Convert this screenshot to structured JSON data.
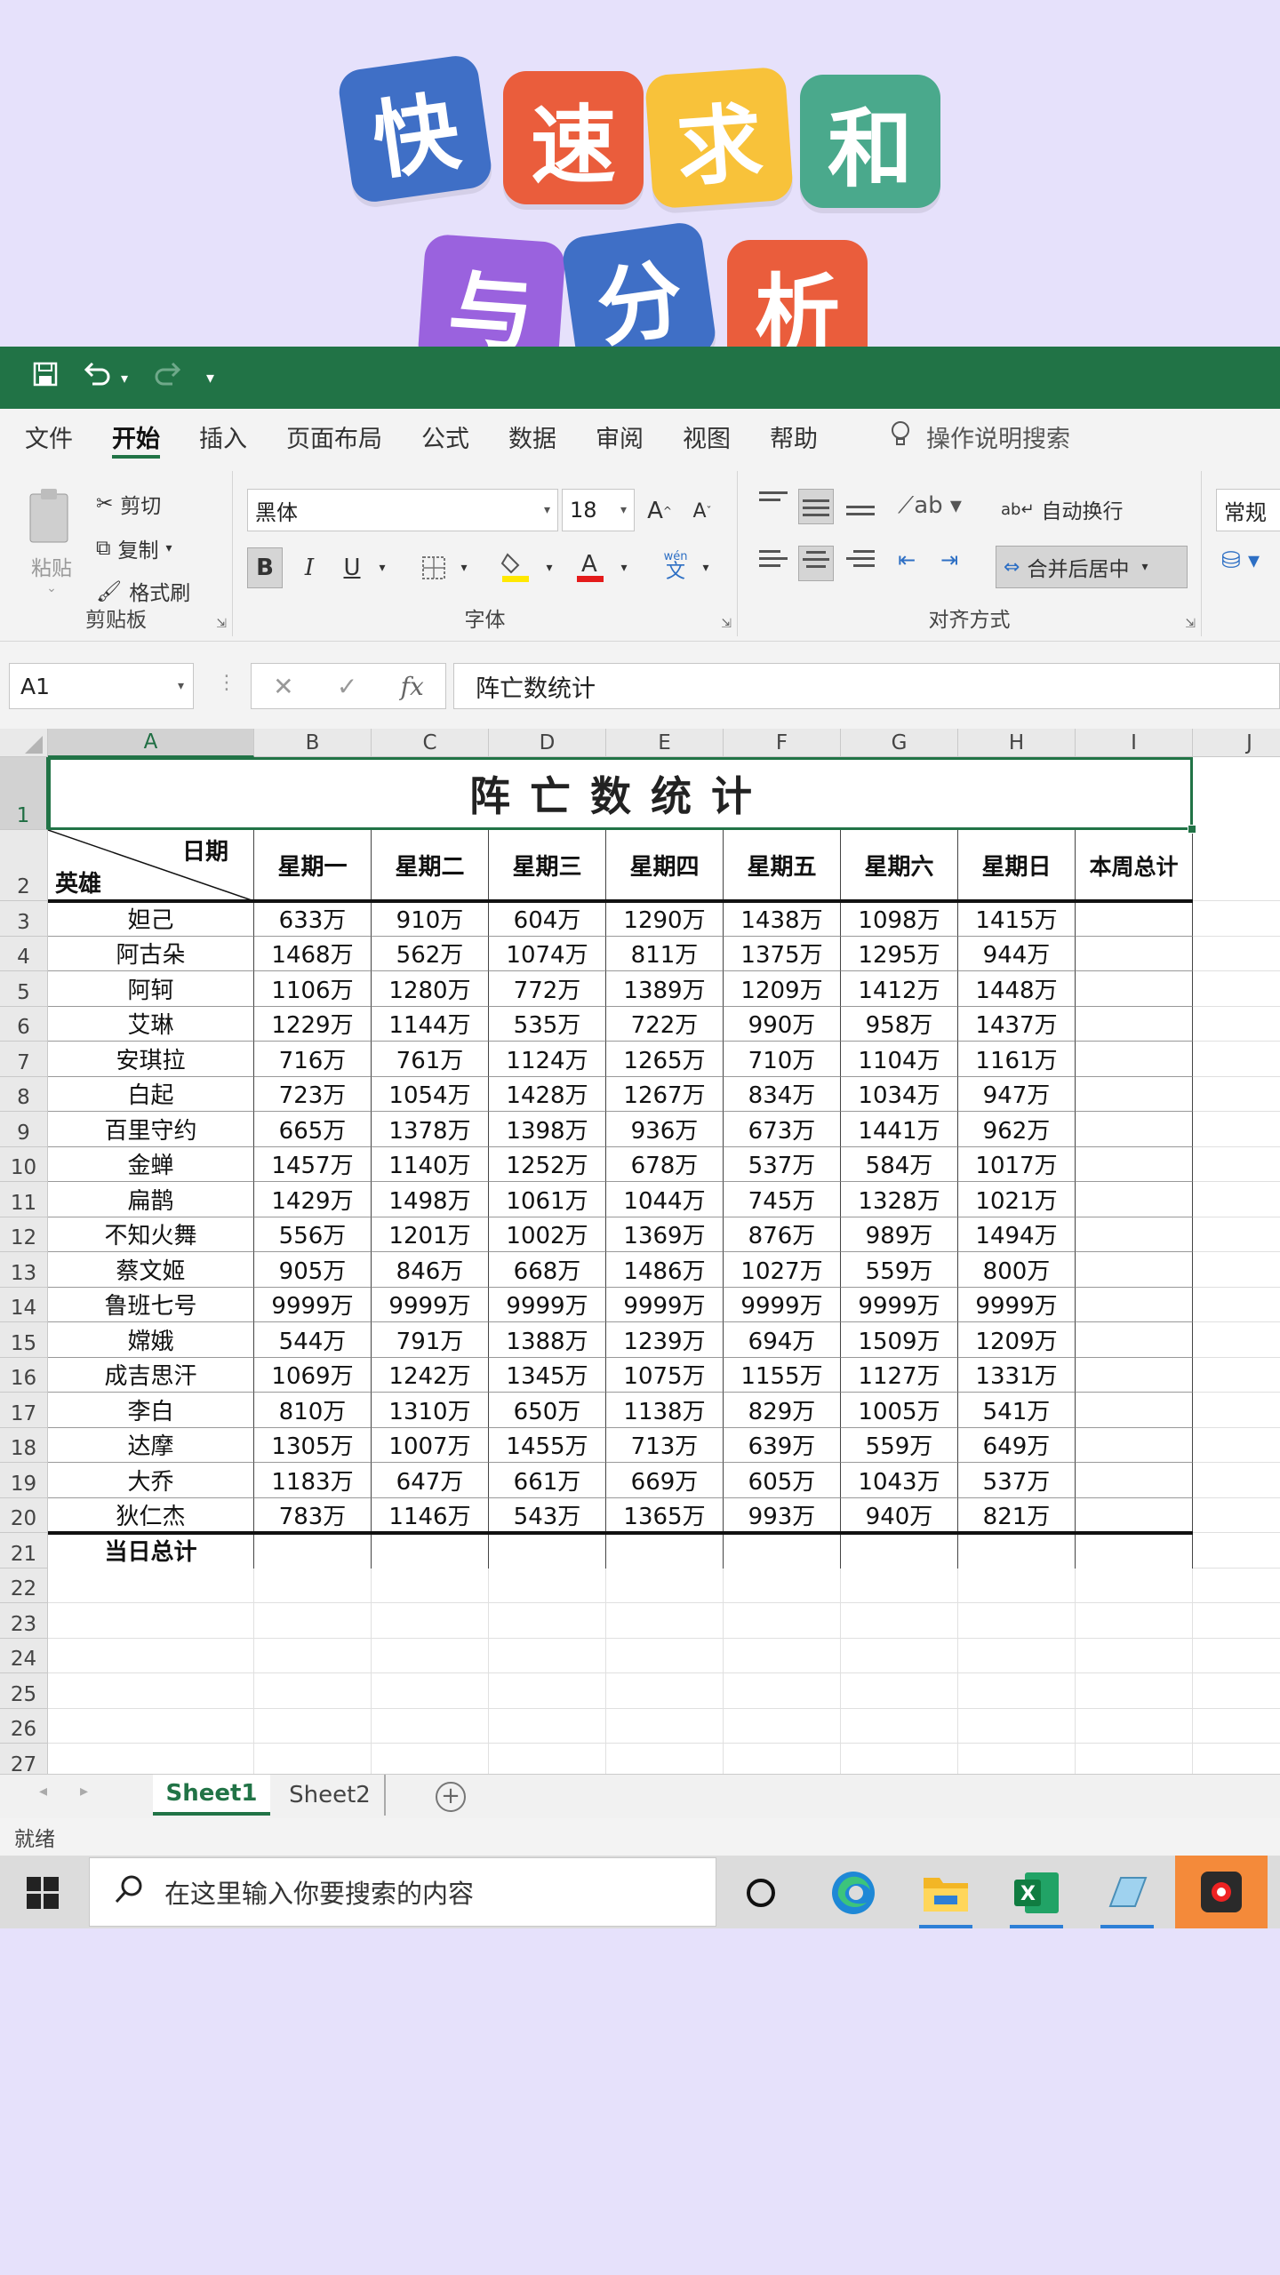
{
  "banner": {
    "line1": [
      "快",
      "速",
      "求",
      "和"
    ],
    "line2": [
      "与",
      "分",
      "析"
    ],
    "colors": [
      "#3f6fc6",
      "#ea5d3c",
      "#f8c23a",
      "#4aa98c",
      "#9a62de",
      "#3f6fc6",
      "#ea5d3c"
    ]
  },
  "qat": {
    "save": "save-icon",
    "undo": "undo-icon",
    "redo": "redo-icon",
    "more": "▾"
  },
  "menu": [
    "文件",
    "开始",
    "插入",
    "页面布局",
    "公式",
    "数据",
    "审阅",
    "视图",
    "帮助"
  ],
  "menu_active": "开始",
  "tell_me": "操作说明搜索",
  "ribbon": {
    "clipboard": {
      "paste": "粘贴",
      "cut": "剪切",
      "copy": "复制",
      "format_painter": "格式刷",
      "label": "剪贴板"
    },
    "font": {
      "name": "黑体",
      "size": "18",
      "grow": "A",
      "shrink": "A",
      "bold": "B",
      "italic": "I",
      "underline": "U",
      "label": "字体",
      "phonetic": "wén"
    },
    "alignment": {
      "wrap": "自动换行",
      "merge": "合并后居中",
      "label": "对齐方式"
    },
    "number": {
      "format": "常规"
    }
  },
  "formula": {
    "name_box": "A1",
    "cancel": "✕",
    "enter": "✓",
    "fx": "fx",
    "content": "阵亡数统计"
  },
  "columns": [
    "A",
    "B",
    "C",
    "D",
    "E",
    "F",
    "G",
    "H",
    "I",
    "J"
  ],
  "rows": [
    "1",
    "2",
    "3",
    "4",
    "5",
    "6",
    "7",
    "8",
    "9",
    "10",
    "11",
    "12",
    "13",
    "14",
    "15",
    "16",
    "17",
    "18",
    "19",
    "20",
    "21",
    "22",
    "23",
    "24",
    "25",
    "26",
    "27"
  ],
  "sheet": {
    "title": "阵亡数统计",
    "corner_top": "日期",
    "corner_bottom": "英雄",
    "headers": [
      "星期一",
      "星期二",
      "星期三",
      "星期四",
      "星期五",
      "星期六",
      "星期日",
      "本周总计"
    ],
    "heroes": [
      {
        "name": "妲己",
        "vals": [
          "633万",
          "910万",
          "604万",
          "1290万",
          "1438万",
          "1098万",
          "1415万"
        ]
      },
      {
        "name": "阿古朵",
        "vals": [
          "1468万",
          "562万",
          "1074万",
          "811万",
          "1375万",
          "1295万",
          "944万"
        ]
      },
      {
        "name": "阿轲",
        "vals": [
          "1106万",
          "1280万",
          "772万",
          "1389万",
          "1209万",
          "1412万",
          "1448万"
        ]
      },
      {
        "name": "艾琳",
        "vals": [
          "1229万",
          "1144万",
          "535万",
          "722万",
          "990万",
          "958万",
          "1437万"
        ]
      },
      {
        "name": "安琪拉",
        "vals": [
          "716万",
          "761万",
          "1124万",
          "1265万",
          "710万",
          "1104万",
          "1161万"
        ]
      },
      {
        "name": "白起",
        "vals": [
          "723万",
          "1054万",
          "1428万",
          "1267万",
          "834万",
          "1034万",
          "947万"
        ]
      },
      {
        "name": "百里守约",
        "vals": [
          "665万",
          "1378万",
          "1398万",
          "936万",
          "673万",
          "1441万",
          "962万"
        ]
      },
      {
        "name": "金蝉",
        "vals": [
          "1457万",
          "1140万",
          "1252万",
          "678万",
          "537万",
          "584万",
          "1017万"
        ]
      },
      {
        "name": "扁鹊",
        "vals": [
          "1429万",
          "1498万",
          "1061万",
          "1044万",
          "745万",
          "1328万",
          "1021万"
        ]
      },
      {
        "name": "不知火舞",
        "vals": [
          "556万",
          "1201万",
          "1002万",
          "1369万",
          "876万",
          "989万",
          "1494万"
        ]
      },
      {
        "name": "蔡文姬",
        "vals": [
          "905万",
          "846万",
          "668万",
          "1486万",
          "1027万",
          "559万",
          "800万"
        ]
      },
      {
        "name": "鲁班七号",
        "vals": [
          "9999万",
          "9999万",
          "9999万",
          "9999万",
          "9999万",
          "9999万",
          "9999万"
        ]
      },
      {
        "name": "嫦娥",
        "vals": [
          "544万",
          "791万",
          "1388万",
          "1239万",
          "694万",
          "1509万",
          "1209万"
        ]
      },
      {
        "name": "成吉思汗",
        "vals": [
          "1069万",
          "1242万",
          "1345万",
          "1075万",
          "1155万",
          "1127万",
          "1331万"
        ]
      },
      {
        "name": "李白",
        "vals": [
          "810万",
          "1310万",
          "650万",
          "1138万",
          "829万",
          "1005万",
          "541万"
        ]
      },
      {
        "name": "达摩",
        "vals": [
          "1305万",
          "1007万",
          "1455万",
          "713万",
          "639万",
          "559万",
          "649万"
        ]
      },
      {
        "name": "大乔",
        "vals": [
          "1183万",
          "647万",
          "661万",
          "669万",
          "605万",
          "1043万",
          "537万"
        ]
      },
      {
        "name": "狄仁杰",
        "vals": [
          "783万",
          "1146万",
          "543万",
          "1365万",
          "993万",
          "940万",
          "821万"
        ]
      }
    ],
    "total_label": "当日总计"
  },
  "tabs": [
    "Sheet1",
    "Sheet2"
  ],
  "active_tab": "Sheet1",
  "status": "就绪",
  "taskbar": {
    "search_placeholder": "在这里输入你要搜索的内容",
    "apps": [
      "cortana-icon",
      "edge-icon",
      "file-explorer-icon",
      "excel-icon",
      "notepad-icon",
      "recorder-icon"
    ]
  }
}
